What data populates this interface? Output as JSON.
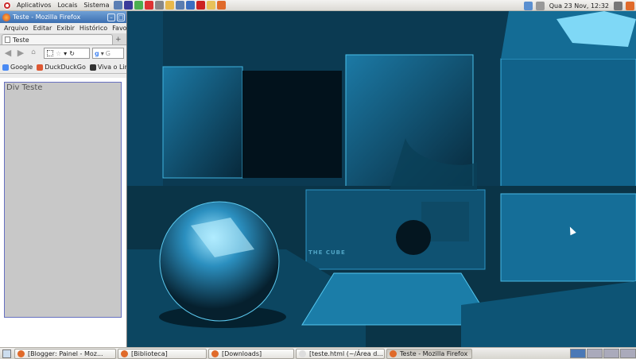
{
  "top_panel": {
    "menus": [
      "Aplicativos",
      "Locais",
      "Sistema"
    ],
    "launchers": [
      {
        "icon": "cube-icon",
        "color": "#5b7fb4"
      },
      {
        "icon": "terminal-icon",
        "color": "#3b3b9a"
      },
      {
        "icon": "chrome-icon",
        "color": "#4caf50"
      },
      {
        "icon": "settings-icon",
        "color": "#d33"
      },
      {
        "icon": "disk-icon",
        "color": "#888"
      },
      {
        "icon": "mail-icon",
        "color": "#e8b84a"
      },
      {
        "icon": "chat-icon",
        "color": "#5a7db0"
      },
      {
        "icon": "globe-icon",
        "color": "#3a6ec0"
      },
      {
        "icon": "filezilla-icon",
        "color": "#c22"
      },
      {
        "icon": "editor-icon",
        "color": "#e8c25a"
      },
      {
        "icon": "firefox-icon",
        "color": "#e06a2a"
      }
    ],
    "datetime": "Qua 23 Nov, 12:32",
    "tray_icons": [
      {
        "icon": "network-icon",
        "color": "#5a8fd0"
      },
      {
        "icon": "search-icon",
        "color": "#999"
      },
      {
        "icon": "volume-icon",
        "color": "#777"
      },
      {
        "icon": "firefox-tray-icon",
        "color": "#e06a2a"
      }
    ]
  },
  "firefox": {
    "window_title": "Teste - Mozilla Firefox",
    "menu": [
      "Arquivo",
      "Editar",
      "Exibir",
      "Histórico",
      "Favo"
    ],
    "tab_title": "Teste",
    "search_placeholder": "G",
    "bookmarks": [
      {
        "label": "Google",
        "color": "#4a8af4"
      },
      {
        "label": "DuckDuckGo",
        "color": "#de5833"
      },
      {
        "label": "Viva o Lir",
        "color": "#333"
      }
    ],
    "div_text": "Div Teste"
  },
  "wallpaper": {
    "watermark": "THE CUBE",
    "accent": "#1a88b8"
  },
  "taskbar": {
    "tasks": [
      {
        "label": "[Blogger: Painel - Moz...",
        "icon_color": "#e06a2a",
        "active": false
      },
      {
        "label": "[Biblioteca]",
        "icon_color": "#e06a2a",
        "active": false
      },
      {
        "label": "[Downloads]",
        "icon_color": "#e06a2a",
        "active": false
      },
      {
        "label": "[teste.html (~/Área d...",
        "icon_color": "#ddd",
        "active": false
      },
      {
        "label": "Teste - Mozilla Firefox",
        "icon_color": "#e06a2a",
        "active": true
      }
    ],
    "workspace_count": 4,
    "active_workspace": 1
  }
}
